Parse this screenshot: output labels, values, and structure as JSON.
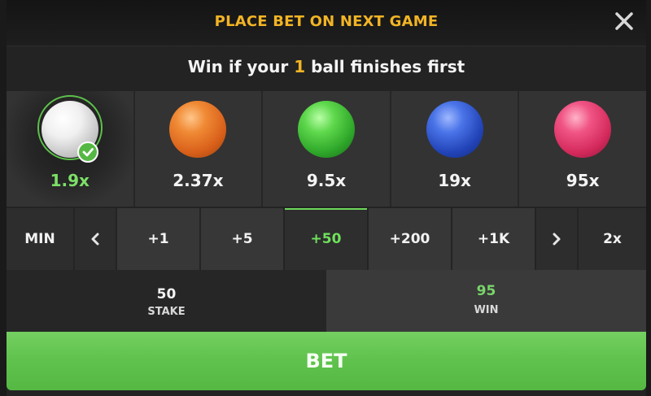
{
  "header": {
    "title": "PLACE BET ON NEXT GAME"
  },
  "instruction": {
    "prefix": "Win if your",
    "count": "1",
    "suffix": "ball finishes first"
  },
  "balls": [
    {
      "color": "white",
      "odds": "1.9x",
      "selected": true,
      "hex": "#e6e6e6"
    },
    {
      "color": "orange",
      "odds": "2.37x",
      "selected": false,
      "hex": "#e96b1f"
    },
    {
      "color": "green",
      "odds": "9.5x",
      "selected": false,
      "hex": "#3fc03a"
    },
    {
      "color": "blue",
      "odds": "19x",
      "selected": false,
      "hex": "#2a55d6"
    },
    {
      "color": "pink",
      "odds": "95x",
      "selected": false,
      "hex": "#e6336a"
    }
  ],
  "stake_controls": {
    "min_label": "MIN",
    "prev_icon": "chevron-left-icon",
    "increments": [
      "+1",
      "+5",
      "+50",
      "+200",
      "+1K"
    ],
    "active_increment": "+50",
    "next_icon": "chevron-right-icon",
    "double_label": "2x"
  },
  "stake": {
    "value": "50",
    "label": "STAKE"
  },
  "win": {
    "value": "95",
    "label": "WIN"
  },
  "bet_button": {
    "label": "BET"
  },
  "colors": {
    "accent_gold": "#f2b425",
    "accent_green": "#5fc24c"
  }
}
